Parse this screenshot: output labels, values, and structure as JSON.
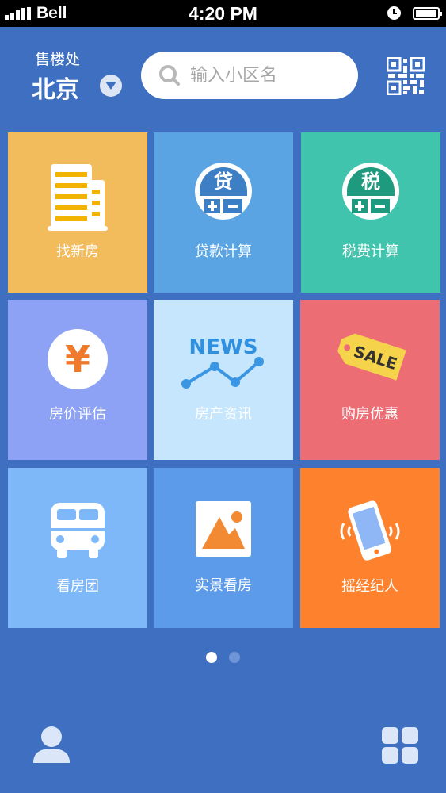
{
  "status_bar": {
    "carrier": "Bell",
    "time": "4:20 PM",
    "icons": [
      "signal-icon",
      "alarm-icon",
      "battery-icon"
    ]
  },
  "header": {
    "city_label": "售楼处",
    "city_name": "北京",
    "search_placeholder": "输入小区名",
    "search_value": "",
    "icons": [
      "chevron-down-icon",
      "search-icon",
      "qr-code-icon"
    ]
  },
  "tiles": [
    {
      "label": "找新房",
      "icon": "building-icon",
      "color": "#f2bb5b"
    },
    {
      "label": "贷款计算",
      "icon": "loan-calculator-icon",
      "icon_text": "贷",
      "color": "#5aa4e4"
    },
    {
      "label": "税费计算",
      "icon": "tax-calculator-icon",
      "icon_text": "税",
      "color": "#41c4ae"
    },
    {
      "label": "房价评估",
      "icon": "yen-icon",
      "icon_text": "¥",
      "color": "#8da2f4"
    },
    {
      "label": "房产资讯",
      "icon": "news-chart-icon",
      "icon_text": "NEWS",
      "color": "#c6e6fd"
    },
    {
      "label": "购房优惠",
      "icon": "sale-tag-icon",
      "icon_text": "SALE",
      "color": "#ed6d75"
    },
    {
      "label": "看房团",
      "icon": "bus-icon",
      "color": "#7fb8f8"
    },
    {
      "label": "实景看房",
      "icon": "picture-icon",
      "color": "#5b9be9"
    },
    {
      "label": "摇经纪人",
      "icon": "shake-phone-icon",
      "color": "#fe822d"
    }
  ],
  "pager": {
    "pages": 2,
    "current": 1
  },
  "bottom_bar": {
    "icons": [
      "profile-icon",
      "grid-menu-icon"
    ]
  },
  "colors": {
    "background": "#3e6fc0",
    "status_bar": "#000000",
    "search_bg": "#ffffff",
    "active_dot": "#ffffff",
    "inactive_dot": "#6f95d6"
  }
}
